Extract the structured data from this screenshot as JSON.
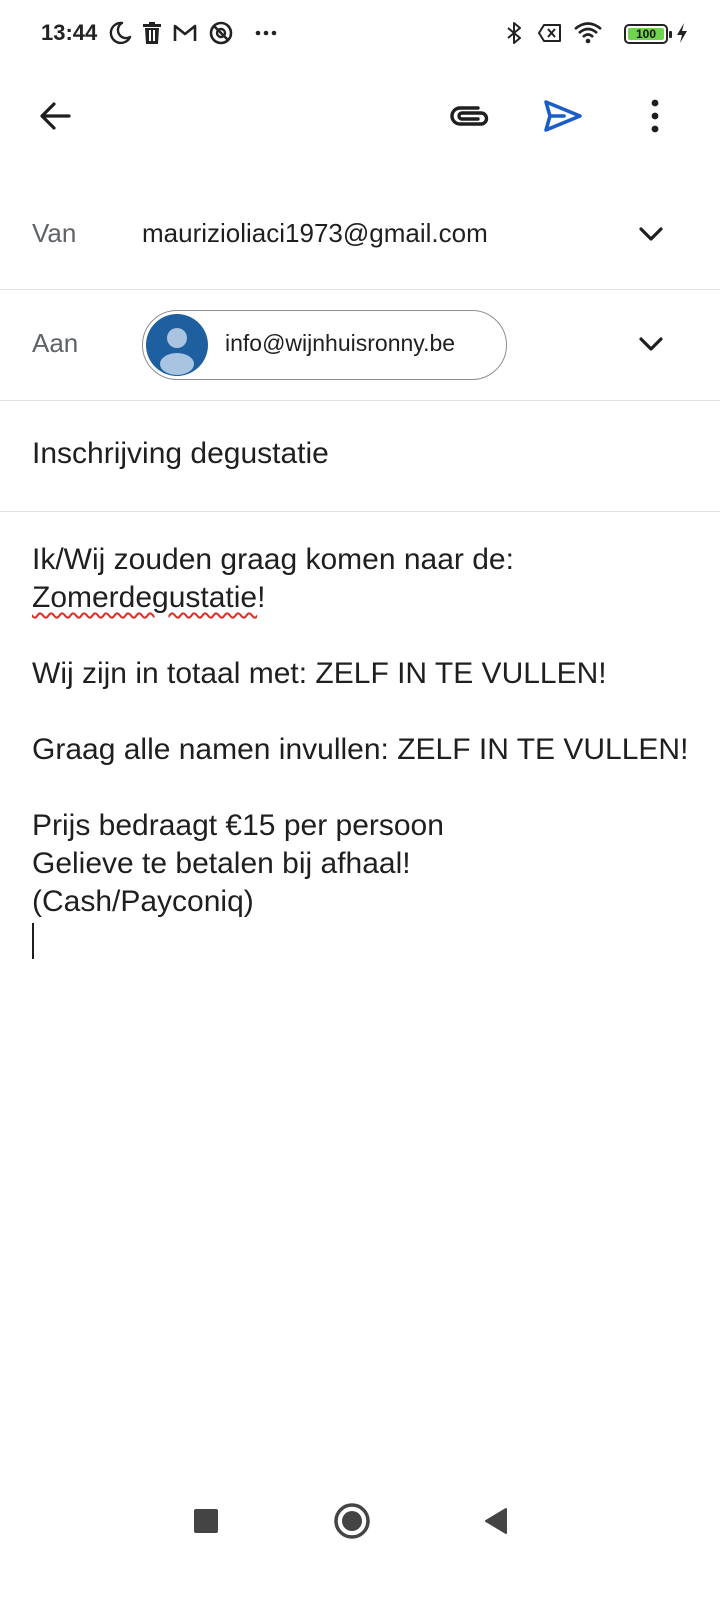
{
  "status_bar": {
    "time": "13:44",
    "battery_level": "100",
    "left_icons": [
      "moon-icon",
      "trash-icon",
      "gmail-icon",
      "do-not-disturb-icon",
      "more-dots-icon"
    ],
    "right_icons": [
      "bluetooth-icon",
      "no-sim-icon",
      "wifi-icon",
      "battery-icon",
      "charging-icon"
    ]
  },
  "toolbar": {
    "back": "back-arrow-icon",
    "attach": "attach-icon",
    "send": "send-icon",
    "more": "more-vert-icon",
    "accent_color": "#1a5dc8"
  },
  "fields": {
    "from_label": "Van",
    "from_value": "maurizioliaci1973@gmail.com",
    "to_label": "Aan",
    "to_chip": "info@wijnhuisronny.be",
    "subject": "Inschrijving degustatie"
  },
  "body": {
    "line1": "Ik/Wij zouden graag komen naar de:",
    "line2_word": "Zomerdegustatie",
    "line2_punct": "!",
    "line3": "Wij zijn in totaal met: ZELF IN TE VULLEN!",
    "line4": "Graag alle namen invullen: ZELF IN TE VULLEN!",
    "line5": "Prijs bedraagt €15 per persoon",
    "line6": "Gelieve te betalen bij afhaal!",
    "line7": "(Cash/Payconiq)"
  },
  "nav_bar": {
    "recents": "recents-square-icon",
    "home": "home-circle-icon",
    "back": "back-triangle-icon"
  }
}
